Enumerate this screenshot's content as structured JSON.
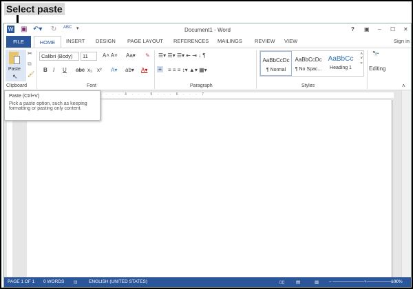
{
  "caption": "Select paste",
  "title": "Document1 - Word",
  "window_controls": [
    "?",
    "▣",
    "–",
    "☐",
    "✕"
  ],
  "sign_in": "Sign in",
  "tabs": [
    "FILE",
    "HOME",
    "INSERT",
    "DESIGN",
    "PAGE LAYOUT",
    "REFERENCES",
    "MAILINGS",
    "REVIEW",
    "VIEW"
  ],
  "clipboard": {
    "paste": "Paste",
    "label": "Clipboard"
  },
  "font": {
    "name": "Calibri (Body)",
    "size": "11",
    "label": "Font",
    "buttons": [
      "B",
      "I",
      "U",
      "abc",
      "x₂",
      "x²"
    ]
  },
  "paragraph": {
    "label": "Paragraph"
  },
  "styles": {
    "label": "Styles",
    "items": [
      {
        "sample": "AaBbCcDc",
        "name": "¶ Normal"
      },
      {
        "sample": "AaBbCcDc",
        "name": "¶ No Spac..."
      },
      {
        "sample": "AaBbCc",
        "name": "Heading 1"
      }
    ]
  },
  "editing": {
    "label": "Editing"
  },
  "tooltip": {
    "title": "Paste (Ctrl+V)",
    "body": "Pick a paste option, such as keeping formatting or pasting only content."
  },
  "ruler": "· · · 1 · · · 2 · · · 3 · · · 4 · · · 5 · · · 6 · · · 7",
  "status": {
    "page": "PAGE 1 OF 1",
    "words": "0 WORDS",
    "language": "ENGLISH (UNITED STATES)",
    "zoom": "100%"
  },
  "colors": {
    "accent": "#2b579a"
  }
}
